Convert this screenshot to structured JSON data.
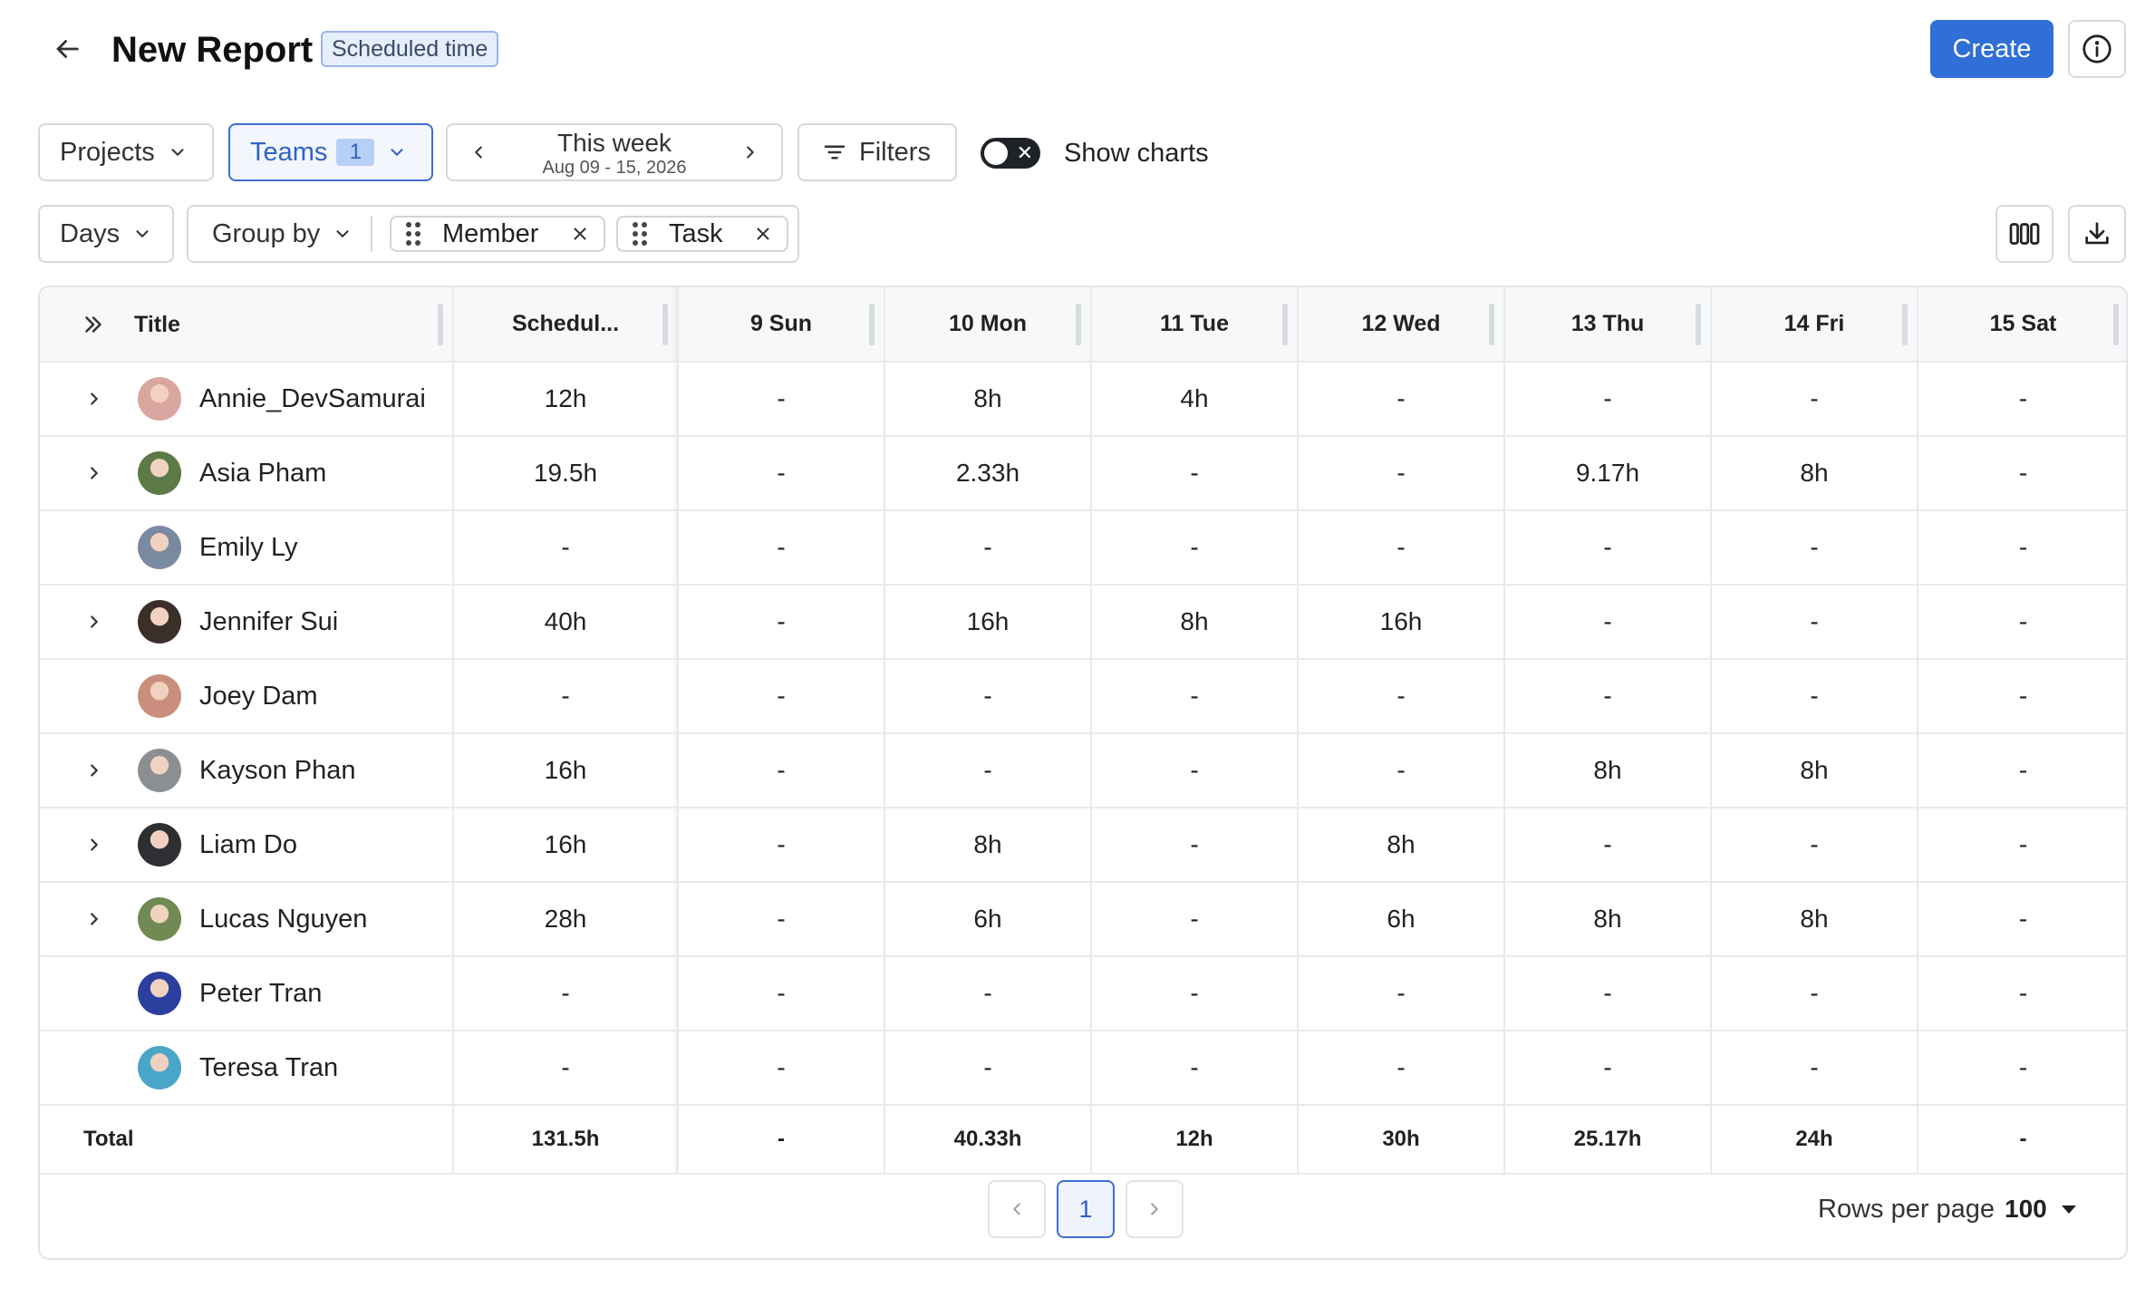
{
  "header": {
    "title": "New Report",
    "badge": "Scheduled time",
    "create_label": "Create"
  },
  "toolbar": {
    "projects_label": "Projects",
    "teams_label": "Teams",
    "teams_count": "1",
    "week_label": "This week",
    "week_range": "Aug 09 - 15, 2026",
    "filters_label": "Filters",
    "show_charts_label": "Show charts",
    "show_charts_on": false
  },
  "grouping": {
    "days_label": "Days",
    "group_by_label": "Group by",
    "chips": [
      "Member",
      "Task"
    ]
  },
  "table": {
    "columns": [
      "Title",
      "Schedul...",
      "9 Sun",
      "10 Mon",
      "11 Tue",
      "12 Wed",
      "13 Thu",
      "14 Fri",
      "15 Sat"
    ],
    "rows": [
      {
        "name": "Annie_DevSamurai",
        "expandable": true,
        "avatar_color": "#d9a6a0",
        "sched": "12h",
        "days": [
          "-",
          "8h",
          "4h",
          "-",
          "-",
          "-",
          "-"
        ]
      },
      {
        "name": "Asia Pham",
        "expandable": true,
        "avatar_color": "#5b7a45",
        "sched": "19.5h",
        "days": [
          "-",
          "2.33h",
          "-",
          "-",
          "9.17h",
          "8h",
          "-"
        ]
      },
      {
        "name": "Emily Ly",
        "expandable": false,
        "avatar_color": "#7a8aa0",
        "sched": "-",
        "days": [
          "-",
          "-",
          "-",
          "-",
          "-",
          "-",
          "-"
        ]
      },
      {
        "name": "Jennifer Sui",
        "expandable": true,
        "avatar_color": "#3b2f2a",
        "sched": "40h",
        "days": [
          "-",
          "16h",
          "8h",
          "16h",
          "-",
          "-",
          "-"
        ]
      },
      {
        "name": "Joey Dam",
        "expandable": false,
        "avatar_color": "#c98f7c",
        "sched": "-",
        "days": [
          "-",
          "-",
          "-",
          "-",
          "-",
          "-",
          "-"
        ]
      },
      {
        "name": "Kayson Phan",
        "expandable": true,
        "avatar_color": "#8c8f92",
        "sched": "16h",
        "days": [
          "-",
          "-",
          "-",
          "-",
          "8h",
          "8h",
          "-"
        ]
      },
      {
        "name": "Liam Do",
        "expandable": true,
        "avatar_color": "#2d2f33",
        "sched": "16h",
        "days": [
          "-",
          "8h",
          "-",
          "8h",
          "-",
          "-",
          "-"
        ]
      },
      {
        "name": "Lucas Nguyen",
        "expandable": true,
        "avatar_color": "#6f8a52",
        "sched": "28h",
        "days": [
          "-",
          "6h",
          "-",
          "6h",
          "8h",
          "8h",
          "-"
        ]
      },
      {
        "name": "Peter Tran",
        "expandable": false,
        "avatar_color": "#2b3f9e",
        "sched": "-",
        "days": [
          "-",
          "-",
          "-",
          "-",
          "-",
          "-",
          "-"
        ]
      },
      {
        "name": "Teresa Tran",
        "expandable": false,
        "avatar_color": "#4aa6c8",
        "sched": "-",
        "days": [
          "-",
          "-",
          "-",
          "-",
          "-",
          "-",
          "-"
        ]
      }
    ],
    "total": {
      "label": "Total",
      "sched": "131.5h",
      "days": [
        "-",
        "40.33h",
        "12h",
        "30h",
        "25.17h",
        "24h",
        "-"
      ]
    }
  },
  "pagination": {
    "current_page": "1",
    "rows_per_page_label": "Rows per page",
    "rows_per_page_value": "100"
  }
}
